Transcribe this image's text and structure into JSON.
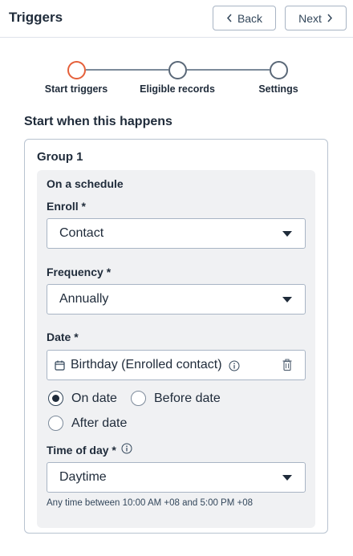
{
  "header": {
    "title": "Triggers",
    "back_label": "Back",
    "next_label": "Next"
  },
  "stepper": {
    "steps": [
      {
        "label": "Start triggers",
        "active": true
      },
      {
        "label": "Eligible records",
        "active": false
      },
      {
        "label": "Settings",
        "active": false
      }
    ]
  },
  "section_title": "Start when this happens",
  "group": {
    "title": "Group 1",
    "trigger": {
      "title": "On a schedule",
      "enroll": {
        "label": "Enroll *",
        "value": "Contact"
      },
      "frequency": {
        "label": "Frequency *",
        "value": "Annually"
      },
      "date": {
        "label": "Date *",
        "value": "Birthday (Enrolled contact)"
      },
      "date_options": [
        {
          "label": "On date",
          "checked": true
        },
        {
          "label": "Before date",
          "checked": false
        },
        {
          "label": "After date",
          "checked": false
        }
      ],
      "time_of_day": {
        "label": "Time of day *",
        "value": "Daytime"
      },
      "helper_text": "Any time between 10:00 AM +08 and 5:00 PM +08"
    }
  },
  "colors": {
    "active_step": "#e5603a",
    "text": "#1f2b3a",
    "panel_bg": "#f0f1f3",
    "border": "#a8b4c4"
  }
}
